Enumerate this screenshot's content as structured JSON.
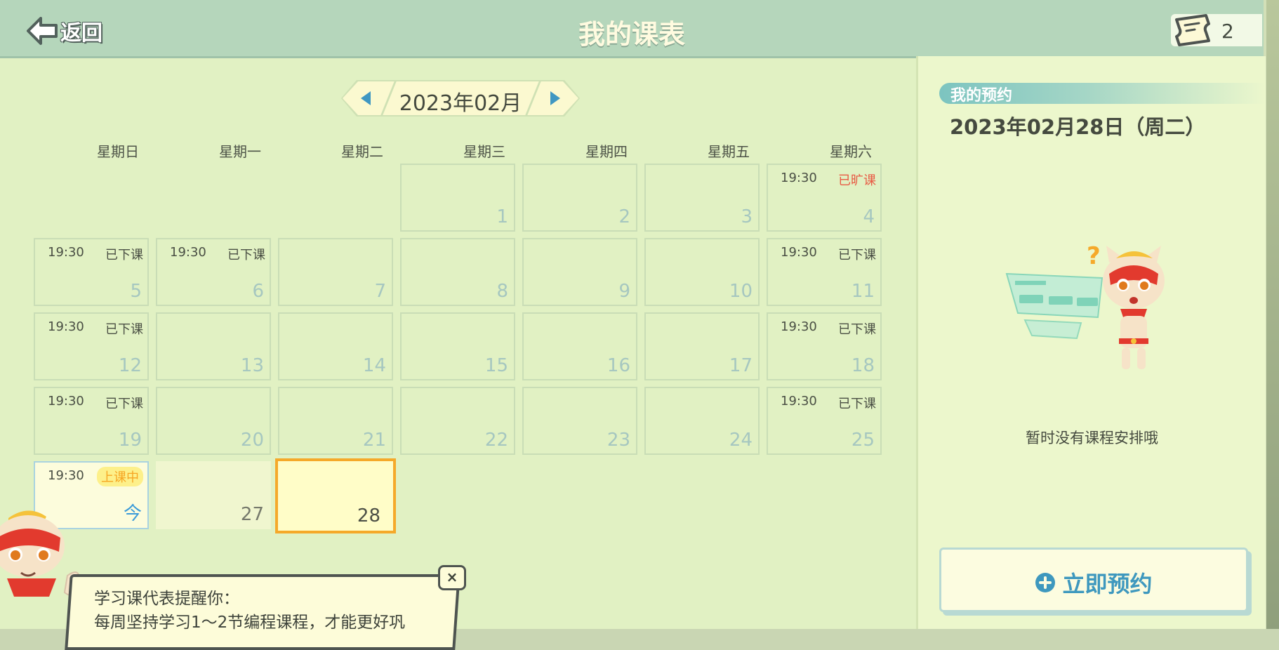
{
  "header": {
    "back_label": "返回",
    "title": "我的课表",
    "ticket_count": "2"
  },
  "calendar": {
    "month_label": "2023年02月",
    "weekdays": [
      "星期日",
      "星期一",
      "星期二",
      "星期三",
      "星期四",
      "星期五",
      "星期六"
    ],
    "weeks": [
      [
        {
          "day": ""
        },
        {
          "day": ""
        },
        {
          "day": ""
        },
        {
          "day": "1"
        },
        {
          "day": "2"
        },
        {
          "day": "3"
        },
        {
          "day": "4",
          "time": "19:30",
          "status": "已旷课",
          "status_type": "absent"
        }
      ],
      [
        {
          "day": "5",
          "time": "19:30",
          "status": "已下课"
        },
        {
          "day": "6",
          "time": "19:30",
          "status": "已下课"
        },
        {
          "day": "7"
        },
        {
          "day": "8"
        },
        {
          "day": "9"
        },
        {
          "day": "10"
        },
        {
          "day": "11",
          "time": "19:30",
          "status": "已下课"
        }
      ],
      [
        {
          "day": "12",
          "time": "19:30",
          "status": "已下课"
        },
        {
          "day": "13"
        },
        {
          "day": "14"
        },
        {
          "day": "15"
        },
        {
          "day": "16"
        },
        {
          "day": "17"
        },
        {
          "day": "18",
          "time": "19:30",
          "status": "已下课"
        }
      ],
      [
        {
          "day": "19",
          "time": "19:30",
          "status": "已下课"
        },
        {
          "day": "20"
        },
        {
          "day": "21"
        },
        {
          "day": "22"
        },
        {
          "day": "23"
        },
        {
          "day": "24"
        },
        {
          "day": "25",
          "time": "19:30",
          "status": "已下课"
        }
      ],
      [
        {
          "day": "今",
          "time": "19:30",
          "status": "上课中",
          "status_type": "live",
          "is_today": true
        },
        {
          "day": "27",
          "plain": true
        },
        {
          "day": "28",
          "selected": true
        }
      ]
    ]
  },
  "reservation": {
    "section_label": "我的预约",
    "selected_date": "2023年02月28日（周二）",
    "empty_text": "暂时没有课程安排哦",
    "book_label": "立即预约"
  },
  "reminder": {
    "line1": "学习课代表提醒你：",
    "line2": "每周坚持学习1～2节编程课程，才能更好巩"
  },
  "colors": {
    "header_bg": "#b5d6bb",
    "page_bg": "#e1f1c3",
    "accent_blue": "#3e98be",
    "selected_border": "#f5a92a",
    "absent_red": "#e85a44"
  }
}
